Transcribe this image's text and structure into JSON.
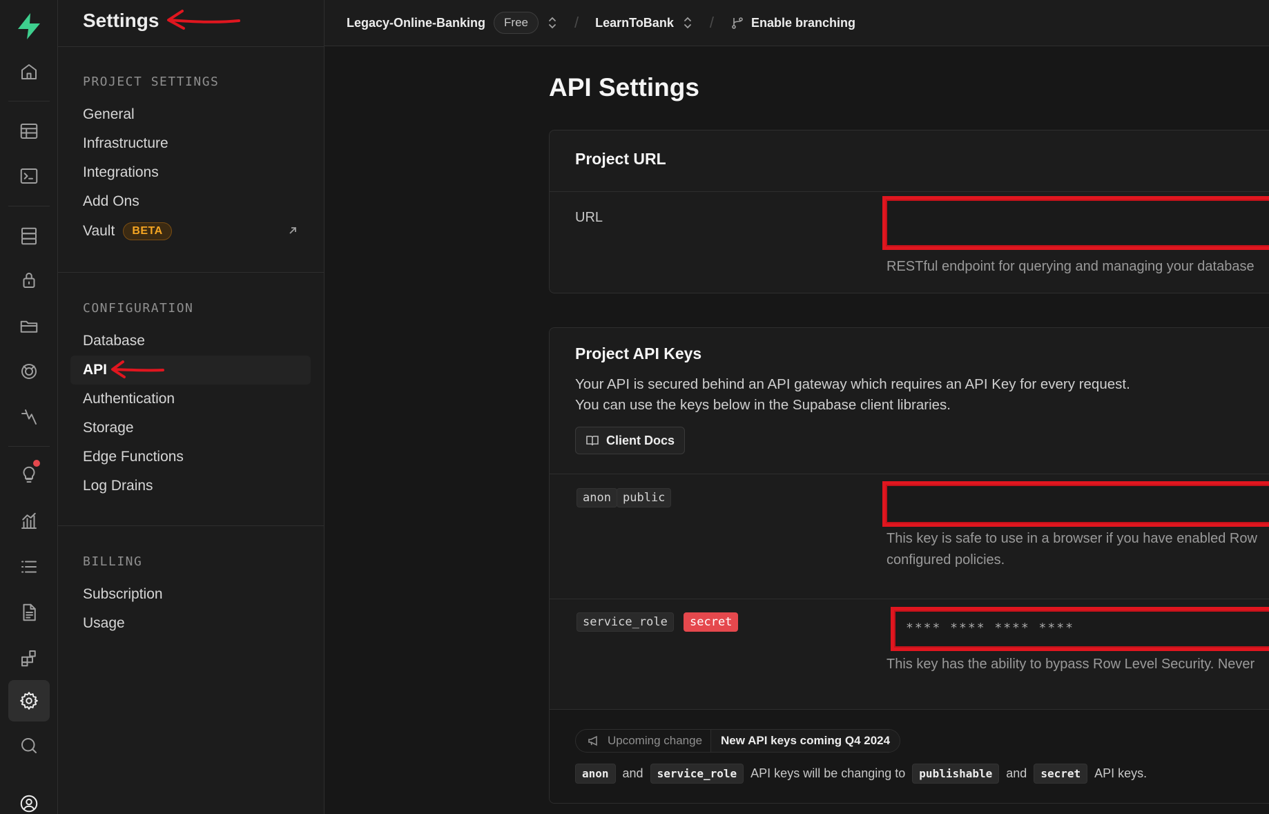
{
  "topbar": {
    "project_name": "Legacy-Online-Banking",
    "plan_badge": "Free",
    "separator": "/",
    "branch_name": "LearnToBank",
    "enable_branching": "Enable branching"
  },
  "rail": {
    "items": [
      "home-icon",
      "table-editor-icon",
      "sql-editor-icon",
      "database-icon",
      "auth-lock-icon",
      "storage-icon",
      "realtime-icon",
      "edge-functions-icon",
      "advisors-icon",
      "reports-icon",
      "logs-icon",
      "api-docs-icon",
      "integrations-icon",
      "settings-icon",
      "search-icon",
      "user-avatar-icon"
    ],
    "active": "settings-icon"
  },
  "sidebar": {
    "title": "Settings",
    "sections": [
      {
        "heading": "PROJECT SETTINGS",
        "items": [
          "General",
          "Infrastructure",
          "Integrations",
          "Add Ons"
        ]
      },
      {
        "heading": "CONFIGURATION",
        "items": [
          "Database",
          "API",
          "Authentication",
          "Storage",
          "Edge Functions",
          "Log Drains"
        ]
      },
      {
        "heading": "BILLING",
        "items": [
          "Subscription",
          "Usage"
        ]
      }
    ],
    "vault_label": "Vault",
    "vault_badge": "BETA",
    "active_item": "API"
  },
  "main": {
    "page_title": "API Settings",
    "project_url": {
      "title": "Project URL",
      "field_label": "URL",
      "help_text": "RESTful endpoint for querying and managing your database"
    },
    "api_keys": {
      "title": "Project API Keys",
      "description_line1": "Your API is secured behind an API gateway which requires an API Key for every request.",
      "description_line2": "You can use the keys below in the Supabase client libraries.",
      "client_docs_button": "Client Docs",
      "anon": {
        "tag1": "anon",
        "tag2": "public",
        "help_line1": "This key is safe to use in a browser if you have enabled Row",
        "help_line2": "configured policies."
      },
      "service_role": {
        "tag1": "service_role",
        "tag2": "secret",
        "masked_value": "**** **** **** ****",
        "help_text": "This key has the ability to bypass Row Level Security. Never"
      },
      "notice": {
        "pill_left": "Upcoming change",
        "pill_right": "New API keys coming Q4 2024",
        "code1": "anon",
        "and1": "and",
        "code2": "service_role",
        "middle": "API keys will be changing to",
        "code3": "publishable",
        "and2": "and",
        "code4": "secret",
        "end": "API keys."
      }
    }
  },
  "colors": {
    "accent_green": "#3ecf8e",
    "annotation_red": "#e0161f",
    "beta_orange": "#f5a623",
    "secret_red": "#e5484d"
  }
}
